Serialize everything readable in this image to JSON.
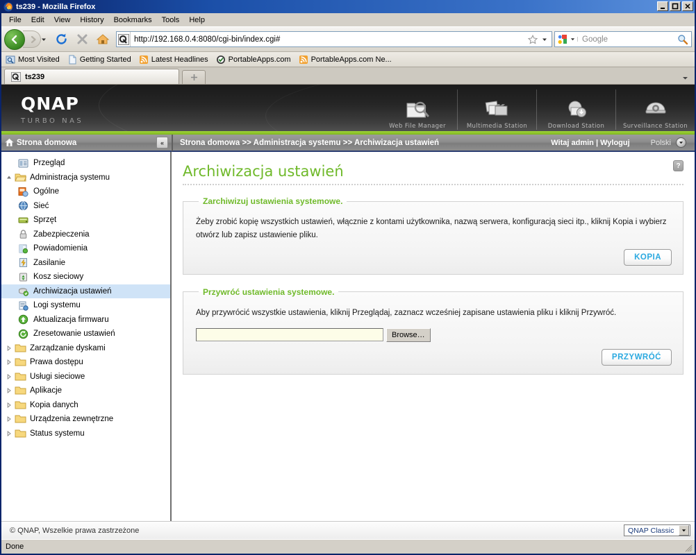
{
  "window": {
    "title": "ts239 - Mozilla Firefox",
    "minimize": "_",
    "maximize": "□",
    "close": "✕"
  },
  "menu": {
    "items": [
      "File",
      "Edit",
      "View",
      "History",
      "Bookmarks",
      "Tools",
      "Help"
    ]
  },
  "toolbar": {
    "back_glyph": "❮",
    "forward_glyph": "❯",
    "dropdown_glyph": "▼",
    "reload_name": "reload",
    "stop_name": "stop",
    "home_name": "home"
  },
  "address": {
    "url": "http://192.168.0.4:8080/cgi-bin/index.cgi#",
    "star_glyph": "☆",
    "arrow_glyph": "▼"
  },
  "search": {
    "placeholder": "Google",
    "arrow_glyph": "▼"
  },
  "bookmarks": {
    "items": [
      {
        "label": "Most Visited",
        "icon": "most-visited-icon"
      },
      {
        "label": "Getting Started",
        "icon": "page-icon"
      },
      {
        "label": "Latest Headlines",
        "icon": "rss-icon"
      },
      {
        "label": "PortableApps.com",
        "icon": "portableapps-icon"
      },
      {
        "label": "PortableApps.com Ne...",
        "icon": "rss-icon"
      }
    ]
  },
  "tabs": {
    "active": "ts239",
    "new_tab_glyph": "✛",
    "scroll_glyph": "▾"
  },
  "banner": {
    "logo": "QNAP",
    "subtitle": "TURBO NAS",
    "apps": [
      {
        "label": "Web File Manager",
        "icon": "folder-search-icon"
      },
      {
        "label": "Multimedia Station",
        "icon": "multimedia-icon"
      },
      {
        "label": "Download Station",
        "icon": "download-icon"
      },
      {
        "label": "Surveillance Station",
        "icon": "camera-icon"
      }
    ]
  },
  "sidebar": {
    "header": "Strona domowa",
    "collapse_glyph": "«",
    "items": [
      {
        "label": "Przegląd",
        "level": 1,
        "icon": "overview-icon",
        "twisty": "",
        "selected": false
      },
      {
        "label": "Administracja systemu",
        "level": 0,
        "icon": "folder-open-icon",
        "twisty": "▲",
        "selected": false
      },
      {
        "label": "Ogólne",
        "level": 1,
        "icon": "general-icon",
        "twisty": "",
        "selected": false
      },
      {
        "label": "Sieć",
        "level": 1,
        "icon": "network-icon",
        "twisty": "",
        "selected": false
      },
      {
        "label": "Sprzęt",
        "level": 1,
        "icon": "hardware-icon",
        "twisty": "",
        "selected": false
      },
      {
        "label": "Zabezpieczenia",
        "level": 1,
        "icon": "lock-icon",
        "twisty": "",
        "selected": false
      },
      {
        "label": "Powiadomienia",
        "level": 1,
        "icon": "notification-icon",
        "twisty": "",
        "selected": false
      },
      {
        "label": "Zasilanie",
        "level": 1,
        "icon": "power-icon",
        "twisty": "",
        "selected": false
      },
      {
        "label": "Kosz sieciowy",
        "level": 1,
        "icon": "recycle-icon",
        "twisty": "",
        "selected": false
      },
      {
        "label": "Archiwizacja ustawień",
        "level": 1,
        "icon": "backup-icon",
        "twisty": "",
        "selected": true
      },
      {
        "label": "Logi systemu",
        "level": 1,
        "icon": "logs-icon",
        "twisty": "",
        "selected": false
      },
      {
        "label": "Aktualizacja firmwaru",
        "level": 1,
        "icon": "firmware-icon",
        "twisty": "",
        "selected": false
      },
      {
        "label": "Zresetowanie ustawień",
        "level": 1,
        "icon": "reset-icon",
        "twisty": "",
        "selected": false
      },
      {
        "label": "Zarządzanie dyskami",
        "level": 0,
        "icon": "folder-icon",
        "twisty": "▷",
        "selected": false
      },
      {
        "label": "Prawa dostępu",
        "level": 0,
        "icon": "folder-icon",
        "twisty": "▷",
        "selected": false
      },
      {
        "label": "Usługi sieciowe",
        "level": 0,
        "icon": "folder-icon",
        "twisty": "▷",
        "selected": false
      },
      {
        "label": "Aplikacje",
        "level": 0,
        "icon": "folder-icon",
        "twisty": "▷",
        "selected": false
      },
      {
        "label": "Kopia danych",
        "level": 0,
        "icon": "folder-icon",
        "twisty": "▷",
        "selected": false
      },
      {
        "label": "Urządzenia zewnętrzne",
        "level": 0,
        "icon": "folder-icon",
        "twisty": "▷",
        "selected": false
      },
      {
        "label": "Status systemu",
        "level": 0,
        "icon": "folder-icon",
        "twisty": "▷",
        "selected": false
      }
    ]
  },
  "breadcrumb": {
    "text": "Strona domowa >> Administracja systemu >> Archiwizacja ustawień",
    "welcome": "Witaj admin | Wyloguj",
    "language": "Polski",
    "language_arrow": "▼"
  },
  "main": {
    "title": "Archiwizacja ustawień",
    "help_glyph": "?",
    "backup_panel": {
      "legend": "Zarchiwizuj ustawienia systemowe.",
      "description": "Żeby zrobić kopię wszystkich ustawień, włącznie z kontami użytkownika, nazwą serwera, konfiguracją sieci itp., kliknij Kopia i wybierz otwórz lub zapisz ustawienie pliku.",
      "button": "KOPIA"
    },
    "restore_panel": {
      "legend": "Przywróć ustawienia systemowe.",
      "description": "Aby przywrócić wszystkie ustawienia, kliknij Przeglądaj, zaznacz wcześniej zapisane ustawienia pliku i kliknij Przywróć.",
      "file_value": "",
      "browse_button": "Browse…",
      "button": "PRZYWRÓĆ"
    }
  },
  "footer": {
    "copyright": "© QNAP, Wszelkie prawa zastrzeżone",
    "theme": "QNAP Classic",
    "theme_arrow": "▼"
  },
  "statusbar": {
    "text": "Done"
  },
  "colors": {
    "accent_green": "#6fb92a",
    "button_blue": "#2aa9e0",
    "titlebar_blue": "#0a246a",
    "selection_blue": "#cfe3f7"
  }
}
